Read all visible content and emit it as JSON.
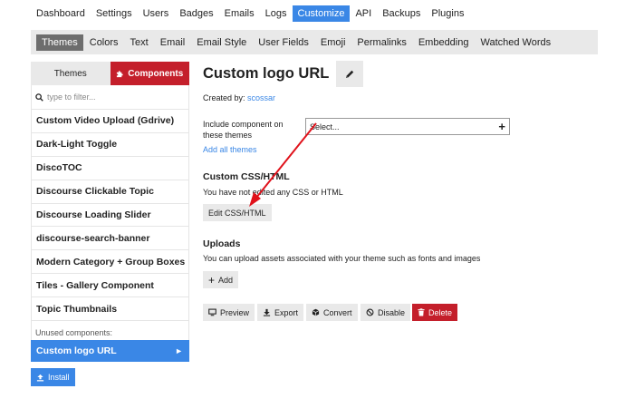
{
  "topnav": {
    "items": [
      "Dashboard",
      "Settings",
      "Users",
      "Badges",
      "Emails",
      "Logs",
      "Customize",
      "API",
      "Backups",
      "Plugins"
    ],
    "active": "Customize"
  },
  "subnav": {
    "items": [
      "Themes",
      "Colors",
      "Text",
      "Email",
      "Email Style",
      "User Fields",
      "Emoji",
      "Permalinks",
      "Embedding",
      "Watched Words"
    ],
    "active": "Themes"
  },
  "sidebar": {
    "tab_themes": "Themes",
    "tab_components": "Components",
    "filter_placeholder": "type to filter...",
    "components": [
      "Custom Video Upload (Gdrive)",
      "Dark-Light Toggle",
      "DiscoTOC",
      "Discourse Clickable Topic",
      "Discourse Loading Slider",
      "discourse-search-banner",
      "Modern Category + Group Boxes",
      "Tiles - Gallery Component",
      "Topic Thumbnails"
    ],
    "unused_label": "Unused components:",
    "unused_selected": "Custom logo URL",
    "install_label": "Install"
  },
  "main": {
    "title": "Custom logo URL",
    "created_by_label": "Created by:",
    "created_by_user": "scossar",
    "include_label": "Include component on these themes",
    "select_placeholder": "Select...",
    "add_all_themes": "Add all themes",
    "css_title": "Custom CSS/HTML",
    "css_text": "You have not edited any CSS or HTML",
    "edit_css_label": "Edit CSS/HTML",
    "uploads_title": "Uploads",
    "uploads_text": "You can upload assets associated with your theme such as fonts and images",
    "add_label": "Add",
    "actions": {
      "preview": "Preview",
      "export": "Export",
      "convert": "Convert",
      "disable": "Disable",
      "delete": "Delete"
    }
  },
  "colors": {
    "accent_blue": "#3a87e6",
    "danger_red": "#c41f2b",
    "annotation_arrow": "#e0121b"
  }
}
